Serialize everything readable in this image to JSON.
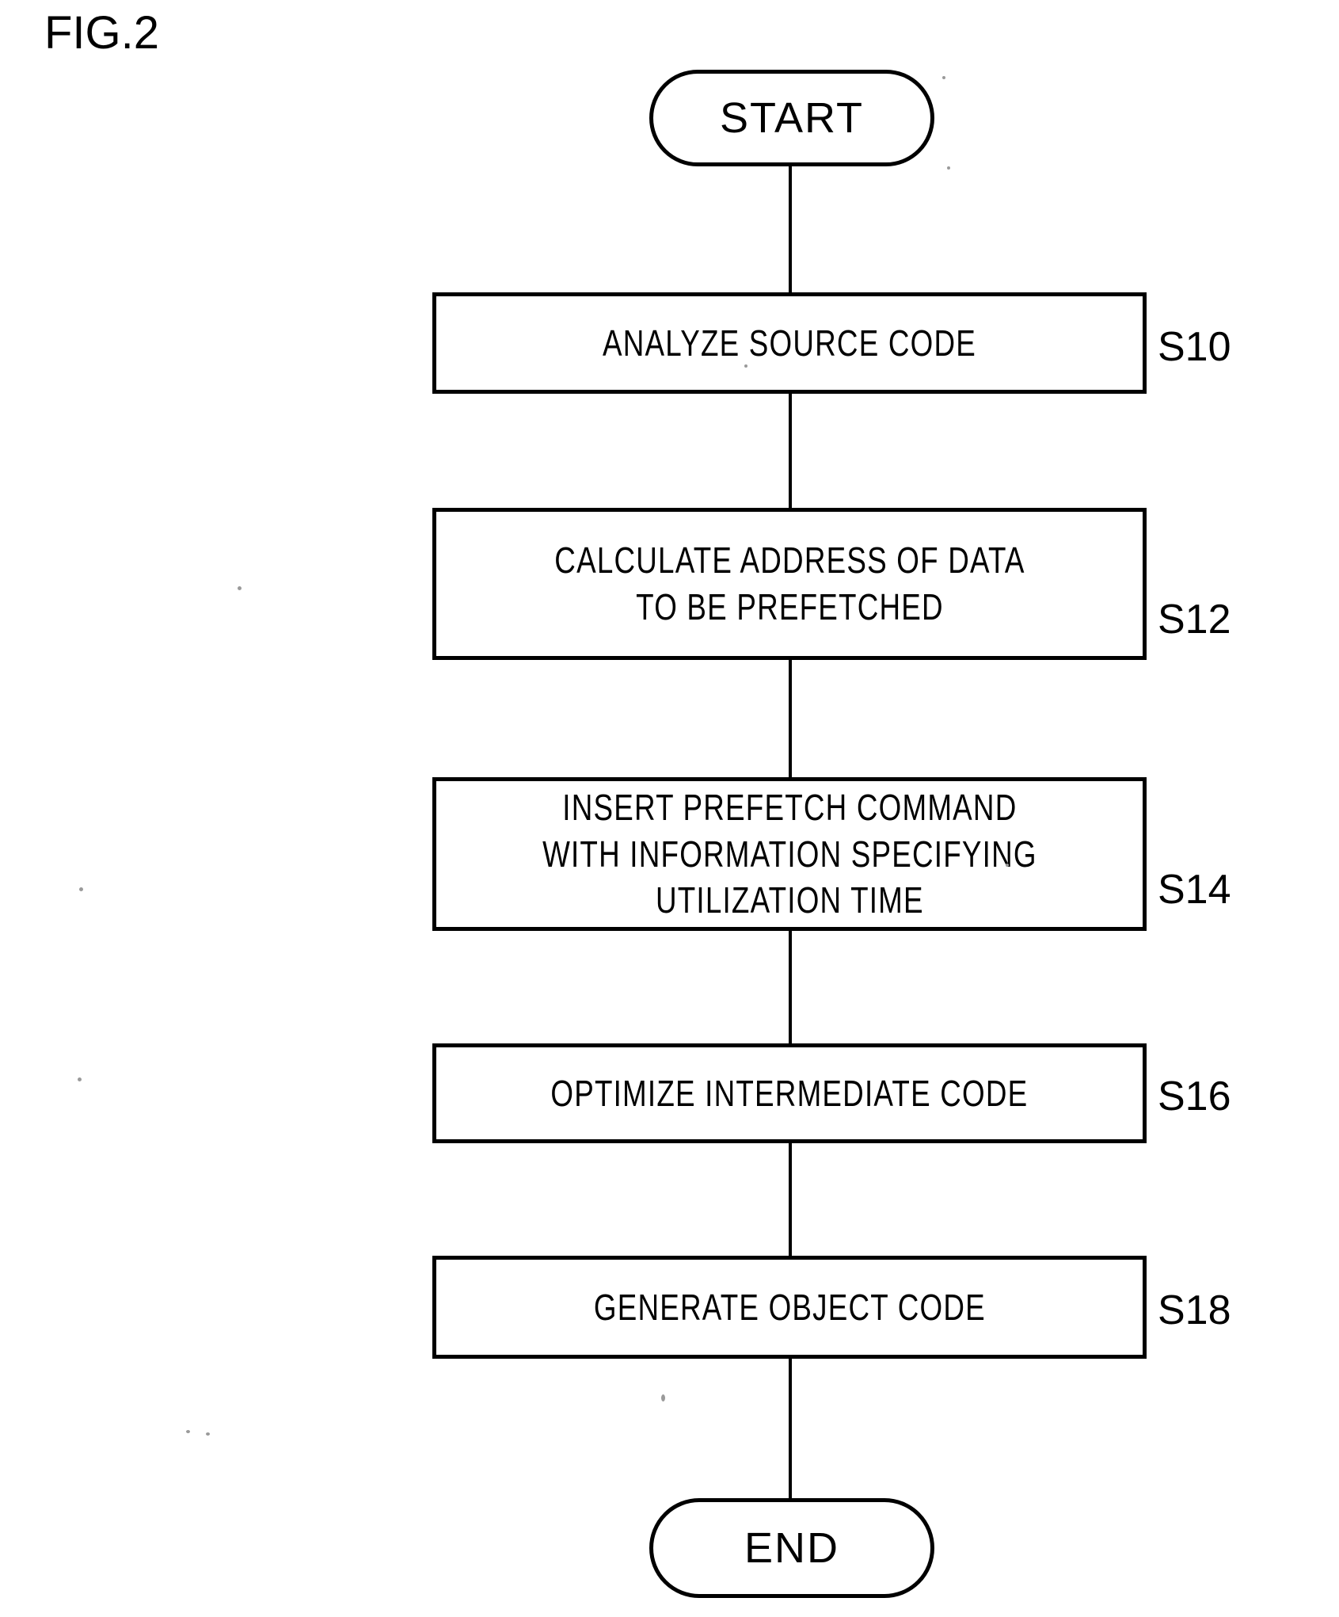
{
  "figure": {
    "title": "FIG.2",
    "type": "flowchart",
    "background_color": "#ffffff",
    "line_color": "#000000"
  },
  "nodes": [
    {
      "id": "start",
      "shape": "terminator",
      "label": "START",
      "step_ref": ""
    },
    {
      "id": "s10",
      "shape": "process",
      "lines": [
        "ANALYZE SOURCE CODE"
      ],
      "step_ref": "S10"
    },
    {
      "id": "s12",
      "shape": "process",
      "lines": [
        "CALCULATE ADDRESS OF DATA",
        "TO BE PREFETCHED"
      ],
      "step_ref": "S12"
    },
    {
      "id": "s14",
      "shape": "process",
      "lines": [
        "INSERT PREFETCH COMMAND",
        "WITH INFORMATION SPECIFYING",
        "UTILIZATION TIME"
      ],
      "step_ref": "S14"
    },
    {
      "id": "s16",
      "shape": "process",
      "lines": [
        "OPTIMIZE INTERMEDIATE CODE"
      ],
      "step_ref": "S16"
    },
    {
      "id": "s18",
      "shape": "process",
      "lines": [
        "GENERATE OBJECT CODE"
      ],
      "step_ref": "S18"
    },
    {
      "id": "end",
      "shape": "terminator",
      "label": "END",
      "step_ref": ""
    }
  ],
  "node_text": {
    "start_label": "START",
    "end_label": "END",
    "s10_line1": "ANALYZE SOURCE CODE",
    "s12_line1": "CALCULATE ADDRESS OF DATA",
    "s12_line2": "TO BE PREFETCHED",
    "s14_line1": "INSERT PREFETCH COMMAND",
    "s14_line2": "WITH INFORMATION SPECIFYING",
    "s14_line3": "UTILIZATION TIME",
    "s16_line1": "OPTIMIZE INTERMEDIATE CODE",
    "s18_line1": "GENERATE OBJECT CODE"
  },
  "step_refs": {
    "s10": "S10",
    "s12": "S12",
    "s14": "S14",
    "s16": "S16",
    "s18": "S18"
  },
  "connectors": [
    {
      "from": "start",
      "to": "s10"
    },
    {
      "from": "s10",
      "to": "s12"
    },
    {
      "from": "s12",
      "to": "s14"
    },
    {
      "from": "s14",
      "to": "s16"
    },
    {
      "from": "s16",
      "to": "s18"
    },
    {
      "from": "s18",
      "to": "end"
    }
  ]
}
